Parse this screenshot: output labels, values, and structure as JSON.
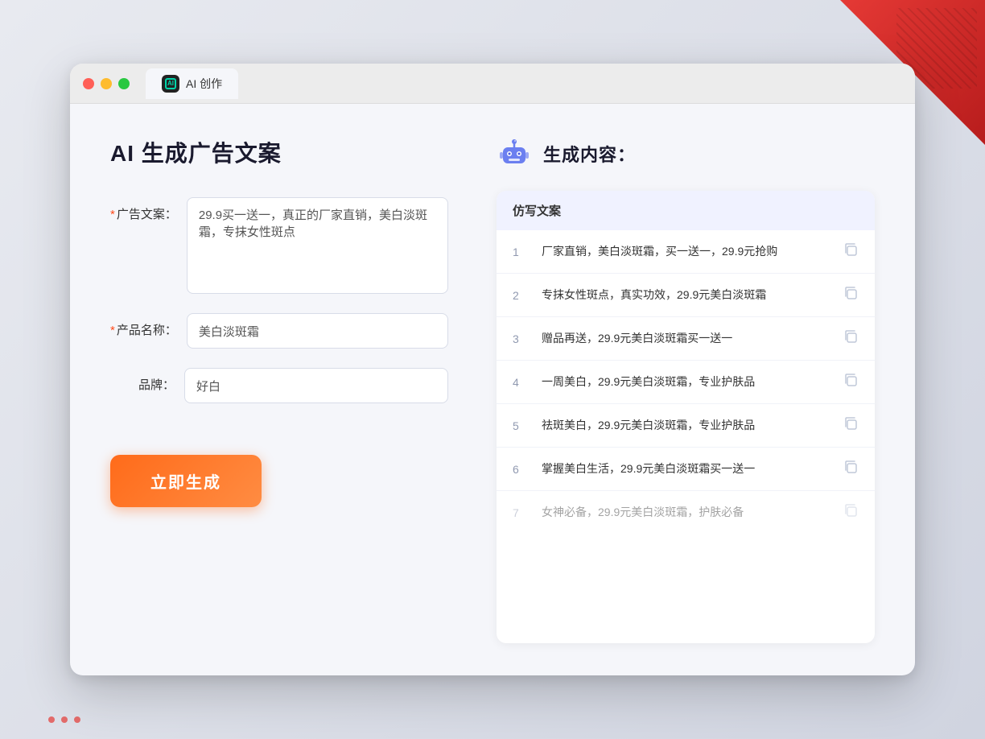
{
  "window": {
    "tab_label": "AI 创作"
  },
  "left_panel": {
    "title": "AI 生成广告文案",
    "form": {
      "ad_copy_label": "广告文案：",
      "ad_copy_required": "*",
      "ad_copy_value": "29.9买一送一，真正的厂家直销，美白淡斑霜，专抹女性斑点",
      "product_name_label": "产品名称：",
      "product_name_required": "*",
      "product_name_value": "美白淡斑霜",
      "brand_label": "品牌：",
      "brand_value": "好白",
      "generate_button": "立即生成"
    }
  },
  "right_panel": {
    "title": "生成内容：",
    "table_header": "仿写文案",
    "results": [
      {
        "id": 1,
        "text": "厂家直销，美白淡斑霜，买一送一，29.9元抢购",
        "dimmed": false
      },
      {
        "id": 2,
        "text": "专抹女性斑点，真实功效，29.9元美白淡斑霜",
        "dimmed": false
      },
      {
        "id": 3,
        "text": "赠品再送，29.9元美白淡斑霜买一送一",
        "dimmed": false
      },
      {
        "id": 4,
        "text": "一周美白，29.9元美白淡斑霜，专业护肤品",
        "dimmed": false
      },
      {
        "id": 5,
        "text": "祛斑美白，29.9元美白淡斑霜，专业护肤品",
        "dimmed": false
      },
      {
        "id": 6,
        "text": "掌握美白生活，29.9元美白淡斑霜买一送一",
        "dimmed": false
      },
      {
        "id": 7,
        "text": "女神必备，29.9元美白淡斑霜，护肤必备",
        "dimmed": true
      }
    ]
  }
}
